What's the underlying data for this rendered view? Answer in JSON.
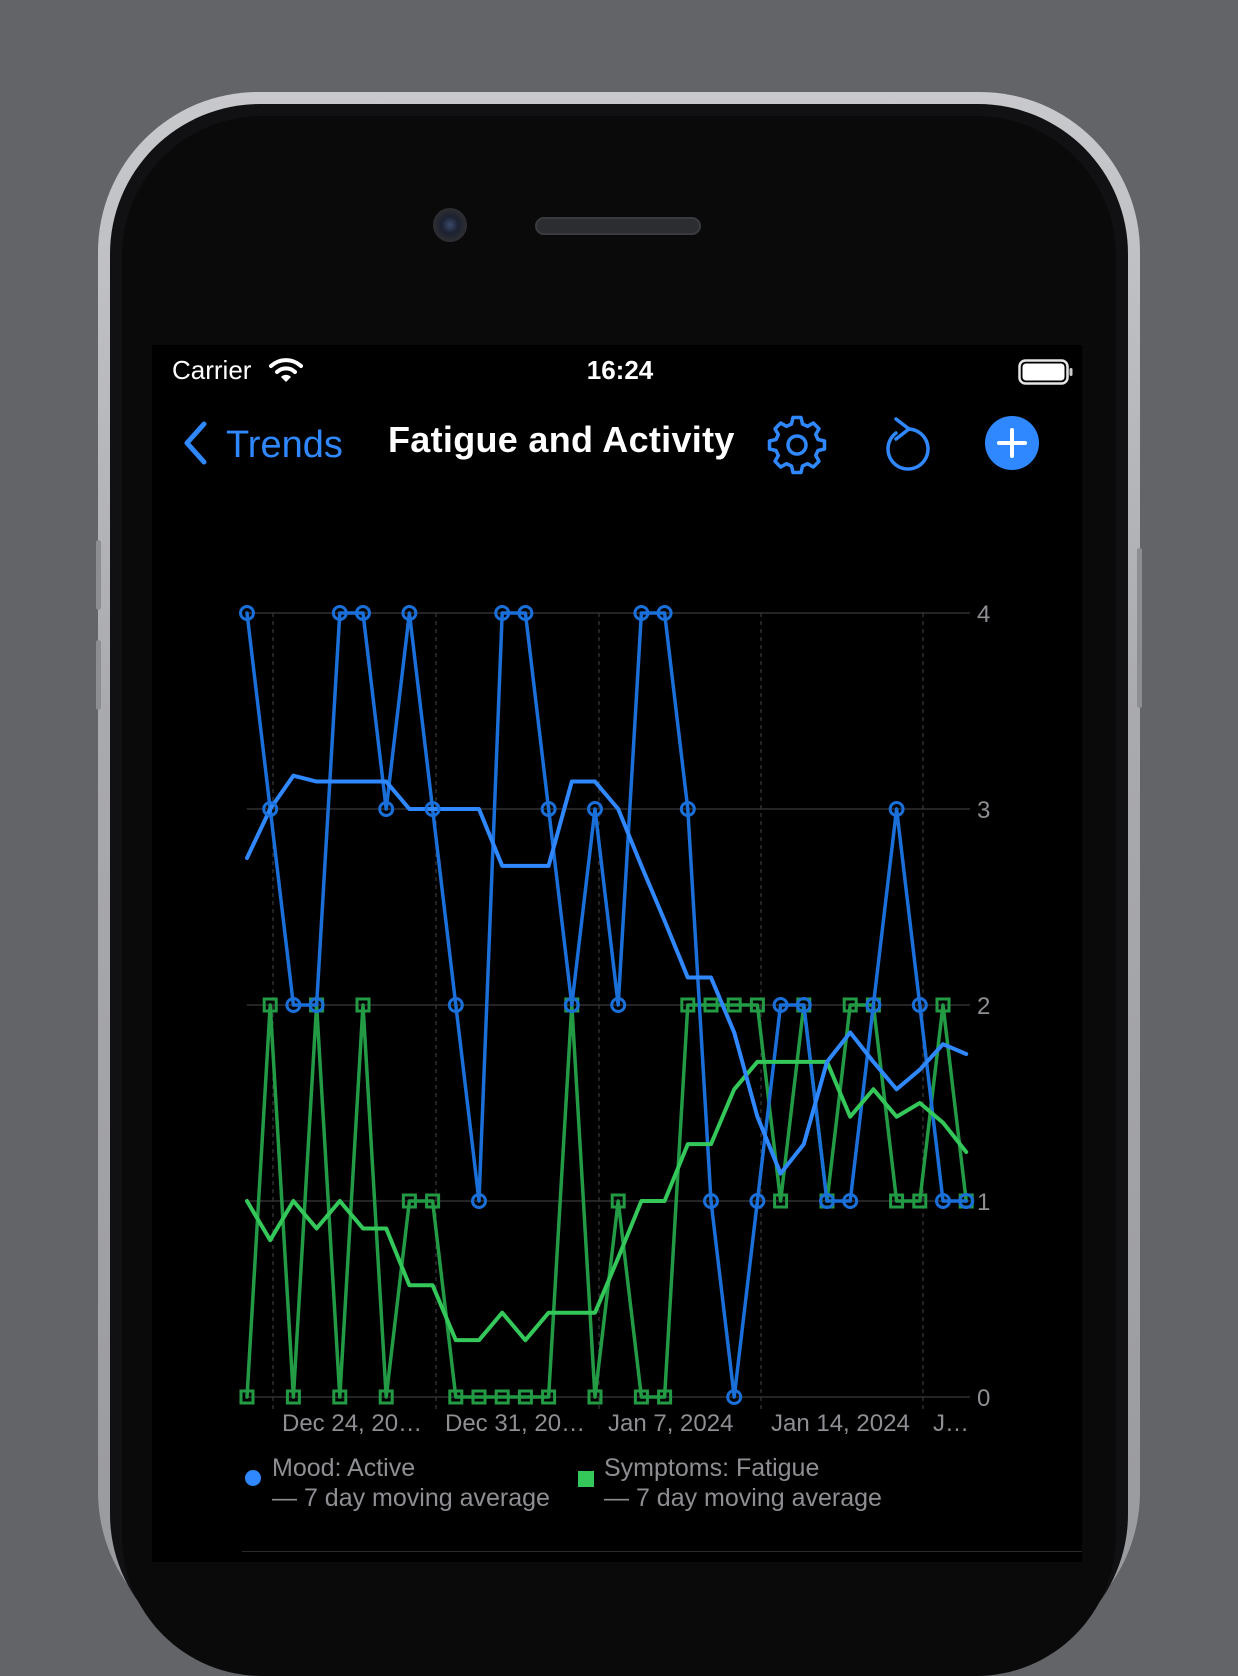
{
  "status": {
    "carrier": "Carrier",
    "time": "16:24"
  },
  "nav": {
    "back_label": "Trends",
    "title": "Fatigue and Activity"
  },
  "colors": {
    "accent": "#2f88ff",
    "mood_line": "#1a6fd9",
    "mood_average": "#2f88ff",
    "symptom_line": "#239b45",
    "symptom_average": "#34c759",
    "grid": "#3a3a3c",
    "axis_text": "#8e8e93"
  },
  "icons": {
    "back": "chevron-left",
    "settings": "gear",
    "reset": "arrow-counterclockwise",
    "add": "plus-circle-fill",
    "wifi": "wifi",
    "battery": "battery-full"
  },
  "legend": [
    {
      "name": "Mood: Active",
      "subtitle": "— 7 day moving average",
      "color": "#1a6fd9"
    },
    {
      "name": "Symptoms: Fatigue",
      "subtitle": "— 7 day moving average",
      "color": "#34c759"
    }
  ],
  "chart_data": {
    "type": "line",
    "x_ticks": [
      "Dec 24, 20…",
      "Dec 31, 20…",
      "Jan 7, 2024",
      "Jan 14, 2024",
      "J…"
    ],
    "y_ticks": [
      "0",
      "1",
      "2",
      "3",
      "4"
    ],
    "ylim": [
      0,
      4
    ],
    "grid": true,
    "y_axis_side": "right",
    "legend_position": "bottom",
    "series": [
      {
        "name": "Mood: Active",
        "markers": "circle",
        "x": [
          0,
          1,
          2,
          3,
          4,
          5,
          6,
          7,
          8,
          9,
          10,
          11,
          12,
          13,
          14,
          15,
          16,
          17,
          18,
          19,
          20,
          21,
          22,
          23,
          24,
          25,
          26,
          27,
          28,
          29,
          30,
          31
        ],
        "values": [
          4,
          3,
          2,
          2,
          4,
          4,
          3,
          4,
          3,
          2,
          1,
          4,
          4,
          3,
          2,
          3,
          2,
          4,
          4,
          3,
          1,
          0,
          1,
          2,
          2,
          1,
          1,
          2,
          3,
          2,
          1,
          1
        ]
      },
      {
        "name": "Mood: Active — 7 day moving average",
        "x": [
          0,
          1,
          2,
          3,
          4,
          5,
          6,
          7,
          8,
          9,
          10,
          11,
          12,
          13,
          14,
          15,
          16,
          17,
          18,
          19,
          20,
          21,
          22,
          23,
          24,
          25,
          26,
          27,
          28,
          29,
          30,
          31
        ],
        "values": [
          2.75,
          3.0,
          3.17,
          3.14,
          3.14,
          3.14,
          3.14,
          3.0,
          3.0,
          3.0,
          3.0,
          2.71,
          2.71,
          2.71,
          3.14,
          3.14,
          3.0,
          2.71,
          2.43,
          2.14,
          2.14,
          1.86,
          1.43,
          1.14,
          1.29,
          1.71,
          1.86,
          1.71,
          1.57,
          1.67,
          1.8,
          1.75
        ]
      },
      {
        "name": "Symptoms: Fatigue",
        "markers": "square",
        "x": [
          0,
          1,
          2,
          3,
          4,
          5,
          6,
          7,
          8,
          9,
          10,
          11,
          12,
          13,
          14,
          15,
          16,
          17,
          18,
          19,
          20,
          21,
          22,
          23,
          24,
          25,
          26,
          27,
          28,
          29,
          30,
          31
        ],
        "values": [
          0,
          2,
          0,
          2,
          0,
          2,
          0,
          1,
          1,
          0,
          0,
          0,
          0,
          0,
          2,
          0,
          1,
          0,
          0,
          2,
          2,
          2,
          2,
          1,
          2,
          1,
          2,
          2,
          1,
          1,
          2,
          1
        ]
      },
      {
        "name": "Symptoms: Fatigue — 7 day moving average",
        "x": [
          0,
          1,
          2,
          3,
          4,
          5,
          6,
          7,
          8,
          9,
          10,
          11,
          12,
          13,
          14,
          15,
          16,
          17,
          18,
          19,
          20,
          21,
          22,
          23,
          24,
          25,
          26,
          27,
          28,
          29,
          30,
          31
        ],
        "values": [
          1.0,
          0.8,
          1.0,
          0.86,
          1.0,
          0.86,
          0.86,
          0.57,
          0.57,
          0.29,
          0.29,
          0.43,
          0.29,
          0.43,
          0.43,
          0.43,
          0.71,
          1.0,
          1.0,
          1.29,
          1.29,
          1.57,
          1.71,
          1.71,
          1.71,
          1.71,
          1.43,
          1.57,
          1.43,
          1.5,
          1.4,
          1.25
        ]
      }
    ]
  }
}
